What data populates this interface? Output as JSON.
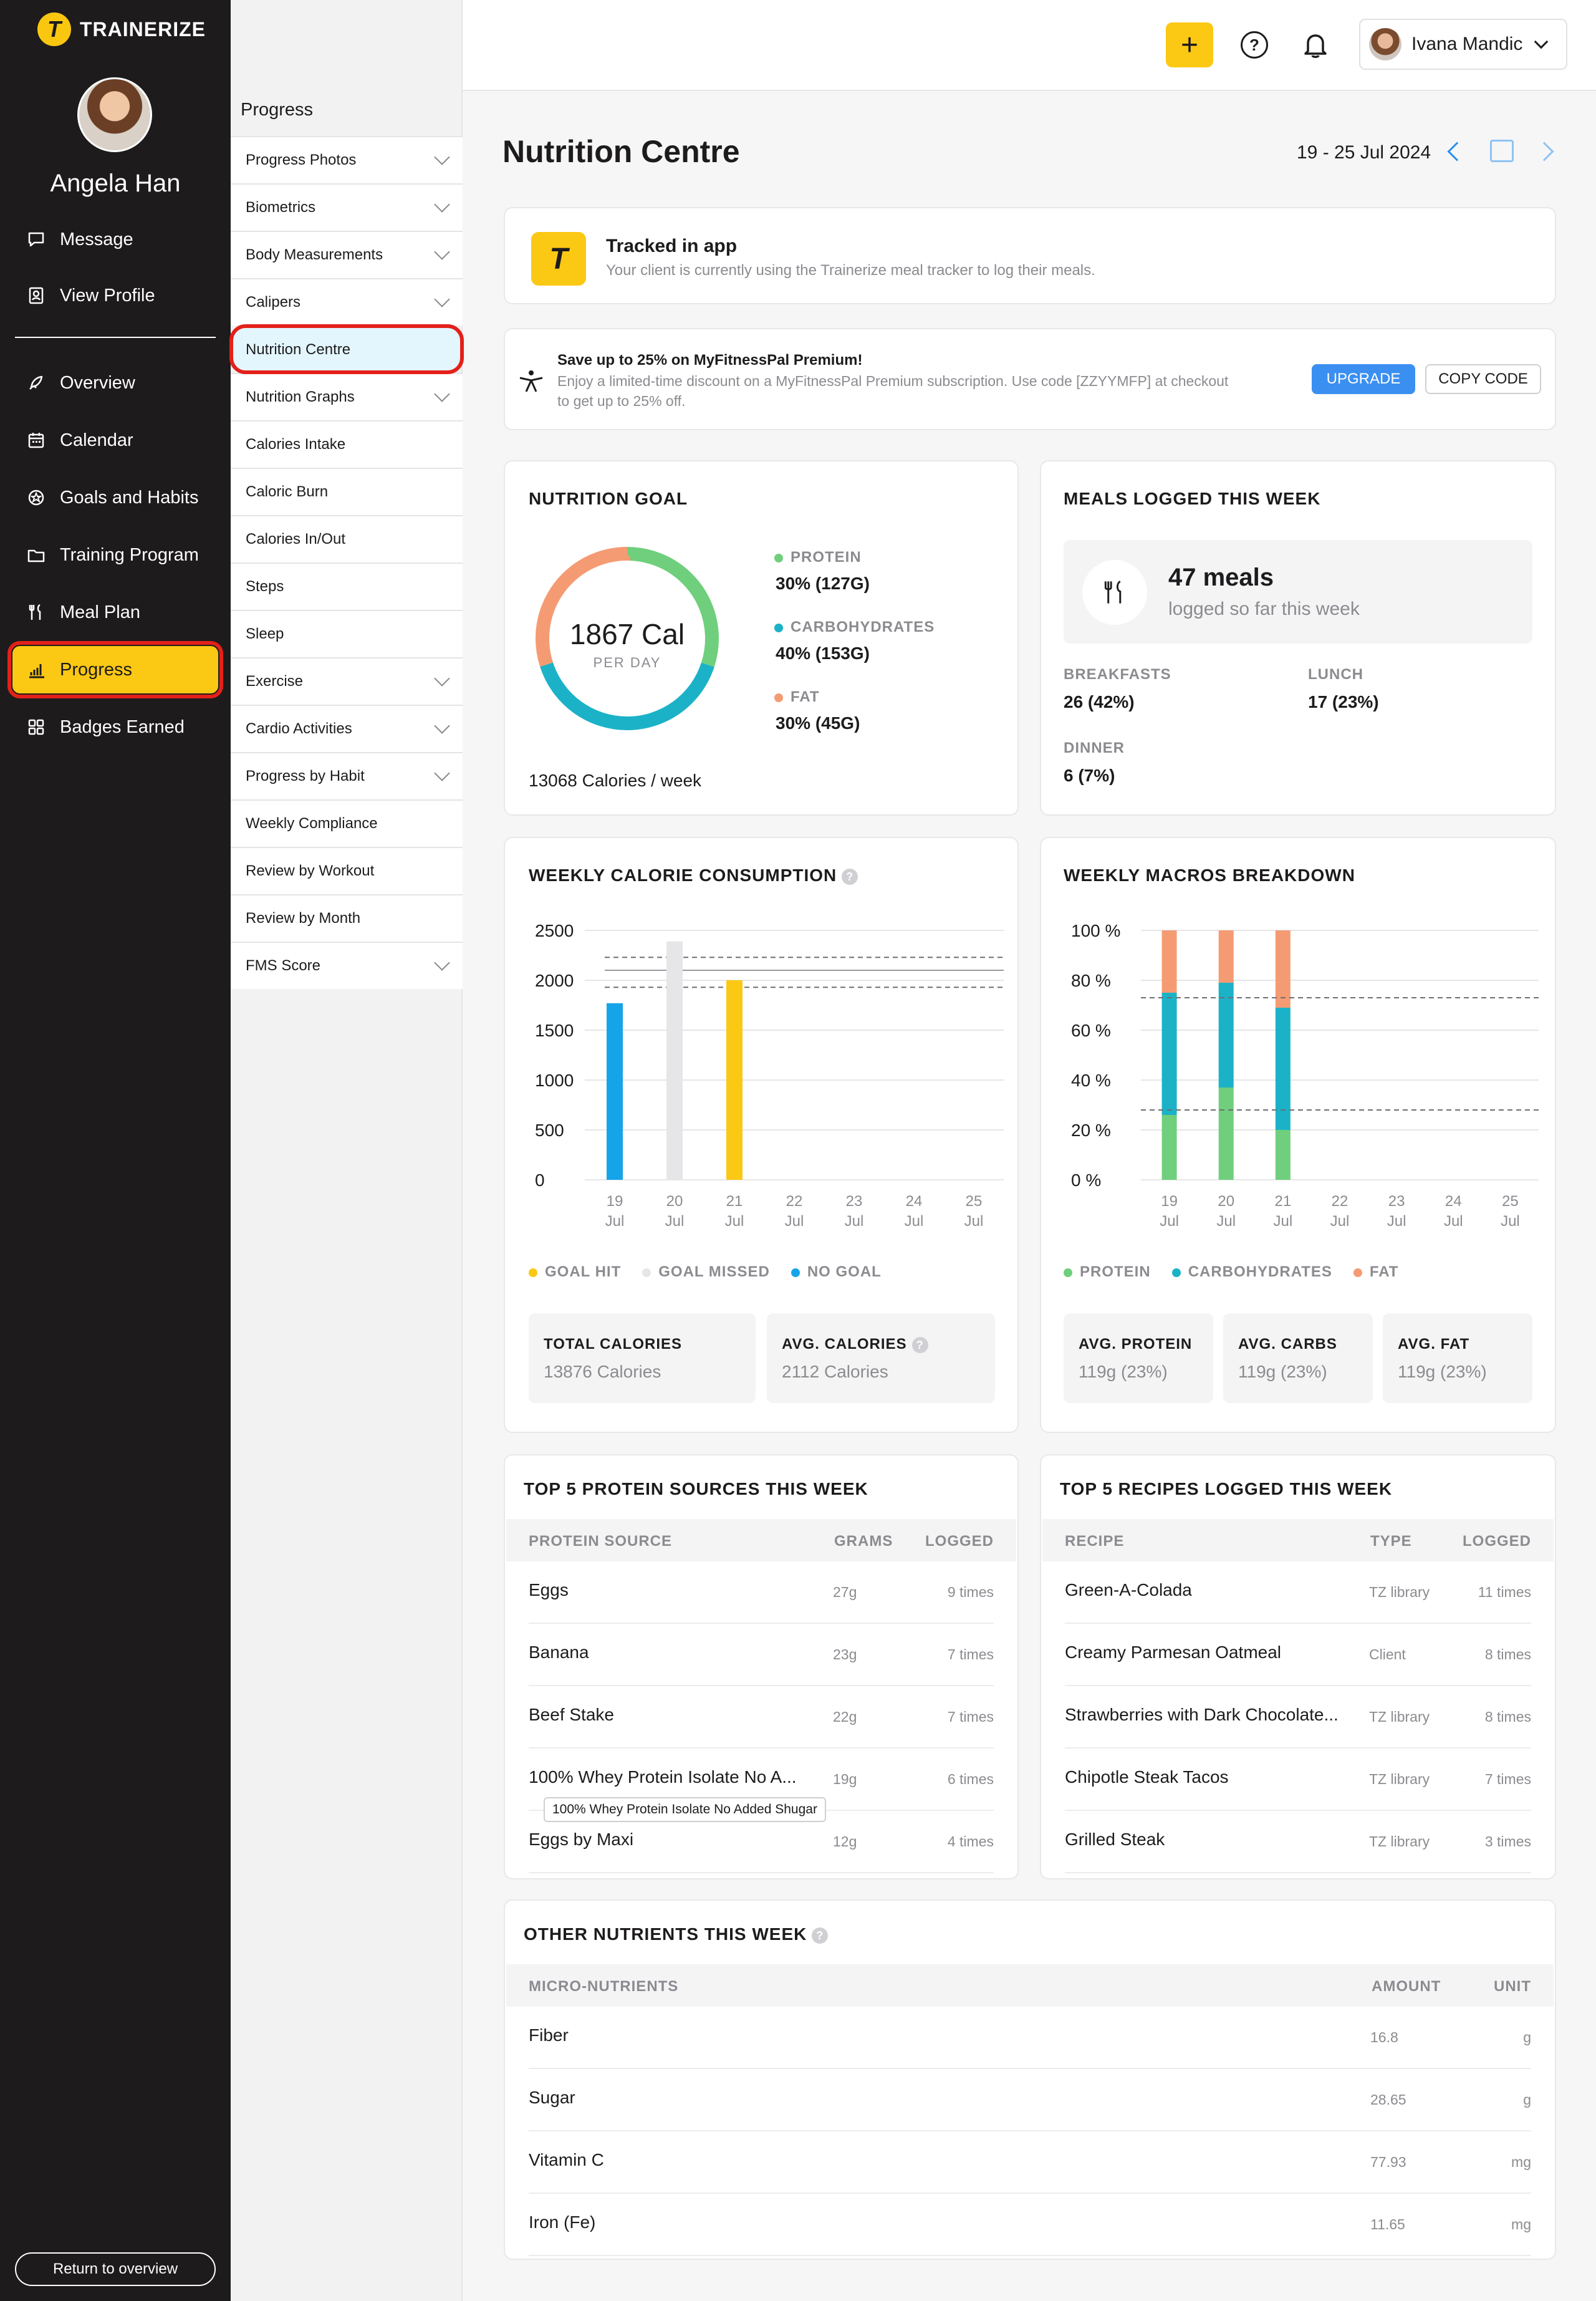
{
  "brand": {
    "name": "TRAINERIZE",
    "accent": "#fbc814",
    "dark": "#1d1b1c",
    "highlight": "#e32119"
  },
  "sidebar": {
    "user_name": "Angela Han",
    "top_items": [
      {
        "label": "Message",
        "icon": "message-icon"
      },
      {
        "label": "View Profile",
        "icon": "profile-icon"
      }
    ],
    "items": [
      {
        "label": "Overview",
        "icon": "rocket-icon"
      },
      {
        "label": "Calendar",
        "icon": "calendar-icon"
      },
      {
        "label": "Goals and Habits",
        "icon": "goal-icon"
      },
      {
        "label": "Training Program",
        "icon": "folder-icon"
      },
      {
        "label": "Meal Plan",
        "icon": "utensils-icon"
      },
      {
        "label": "Progress",
        "icon": "bar-chart-icon",
        "active": true
      },
      {
        "label": "Badges Earned",
        "icon": "grid-icon"
      }
    ],
    "return_label": "Return to overview"
  },
  "subnav": {
    "title": "Progress",
    "items": [
      {
        "label": "Progress Photos",
        "expandable": true
      },
      {
        "label": "Biometrics",
        "expandable": true
      },
      {
        "label": "Body Measurements",
        "expandable": true
      },
      {
        "label": "Calipers",
        "expandable": true
      },
      {
        "label": "Nutrition Centre",
        "expandable": false,
        "selected": true
      },
      {
        "label": "Nutrition Graphs",
        "expandable": true
      },
      {
        "label": "Calories Intake",
        "expandable": false
      },
      {
        "label": "Caloric Burn",
        "expandable": false
      },
      {
        "label": "Calories In/Out",
        "expandable": false
      },
      {
        "label": "Steps",
        "expandable": false
      },
      {
        "label": "Sleep",
        "expandable": false
      },
      {
        "label": "Exercise",
        "expandable": true
      },
      {
        "label": "Cardio Activities",
        "expandable": true
      },
      {
        "label": "Progress by Habit",
        "expandable": true
      },
      {
        "label": "Weekly Compliance",
        "expandable": false
      },
      {
        "label": "Review by Workout",
        "expandable": false
      },
      {
        "label": "Review by Month",
        "expandable": false
      },
      {
        "label": "FMS Score",
        "expandable": true
      }
    ]
  },
  "topbar": {
    "plus": "+",
    "help": "?",
    "account_name": "Ivana Mandic"
  },
  "main": {
    "title": "Nutrition Centre",
    "date_range": "19 - 25 Jul 2024",
    "tracked": {
      "title": "Tracked in app",
      "subtitle": "Your client is currently using the Trainerize meal tracker to log their meals."
    },
    "promo": {
      "title": "Save up to 25% on MyFitnessPal Premium!",
      "text_1": "Enjoy a limited-time discount on a MyFitnessPal Premium subscription. Use code [ZZYYMFP] at checkout",
      "text_2": "to get up to 25% off.",
      "upgrade_label": "UPGRADE",
      "copy_label": "COPY CODE"
    },
    "nutrition_goal": {
      "title": "NUTRITION GOAL",
      "calories": "1867 Cal",
      "per_day": "PER DAY",
      "weekly": "13068 Calories / week",
      "macros": [
        {
          "name": "PROTEIN",
          "value": "30% (127G)",
          "percent": 30,
          "color": "#6fcf7c"
        },
        {
          "name": "CARBOHYDRATES",
          "value": "40% (153G)",
          "percent": 40,
          "color": "#1bb2c8"
        },
        {
          "name": "FAT",
          "value": "30% (45G)",
          "percent": 30,
          "color": "#f59b73"
        }
      ]
    },
    "meals_logged": {
      "title": "MEALS LOGGED THIS WEEK",
      "count": "47 meals",
      "subtitle": "logged so far this week",
      "breakdown": [
        {
          "label": "BREAKFASTS",
          "value": "26 (42%)"
        },
        {
          "label": "LUNCH",
          "value": "17 (23%)"
        },
        {
          "label": "DINNER",
          "value": "6 (7%)"
        }
      ]
    },
    "calorie_consumption": {
      "title": "WEEKLY CALORIE CONSUMPTION",
      "legend": [
        {
          "label": "GOAL HIT",
          "color": "#fbc814"
        },
        {
          "label": "GOAL MISSED",
          "color": "#e6e6e8"
        },
        {
          "label": "NO GOAL",
          "color": "#16a4e8"
        }
      ],
      "stats": [
        {
          "label": "TOTAL CALORIES",
          "value": "13876 Calories"
        },
        {
          "label": "AVG. CALORIES",
          "value": "2112 Calories"
        }
      ]
    },
    "macros_breakdown": {
      "title": "WEEKLY MACROS BREAKDOWN",
      "legend": [
        {
          "label": "PROTEIN",
          "color": "#6fcf7c"
        },
        {
          "label": "CARBOHYDRATES",
          "color": "#1bb2c8"
        },
        {
          "label": "FAT",
          "color": "#f59b73"
        }
      ],
      "stats": [
        {
          "label": "AVG. PROTEIN",
          "value": "119g (23%)"
        },
        {
          "label": "AVG. CARBS",
          "value": "119g (23%)"
        },
        {
          "label": "AVG. FAT",
          "value": "119g (23%)"
        }
      ]
    },
    "protein_sources": {
      "title": "TOP 5 PROTEIN SOURCES THIS WEEK",
      "headers": [
        "PROTEIN SOURCE",
        "GRAMS",
        "LOGGED"
      ],
      "rows": [
        {
          "name": "Eggs",
          "grams": "27g",
          "logged": "9 times"
        },
        {
          "name": "Banana",
          "grams": "23g",
          "logged": "7 times"
        },
        {
          "name": "Beef Stake",
          "grams": "22g",
          "logged": "7 times"
        },
        {
          "name": "100% Whey Protein Isolate No A...",
          "grams": "19g",
          "logged": "6 times"
        },
        {
          "name": "Eggs by Maxi",
          "grams": "12g",
          "logged": "4 times"
        }
      ],
      "tooltip": "100% Whey Protein Isolate No Added Shugar"
    },
    "recipes": {
      "title": "TOP 5 RECIPES LOGGED THIS WEEK",
      "headers": [
        "RECIPE",
        "TYPE",
        "LOGGED"
      ],
      "rows": [
        {
          "name": "Green-A-Colada",
          "type": "TZ library",
          "logged": "11 times"
        },
        {
          "name": "Creamy Parmesan Oatmeal",
          "type": "Client",
          "logged": "8 times"
        },
        {
          "name": "Strawberries with Dark Chocolate...",
          "type": "TZ library",
          "logged": "8 times"
        },
        {
          "name": "Chipotle Steak Tacos",
          "type": "TZ library",
          "logged": "7 times"
        },
        {
          "name": "Grilled Steak",
          "type": "TZ library",
          "logged": "3 times"
        }
      ]
    },
    "other_nutrients": {
      "title": "OTHER NUTRIENTS THIS WEEK",
      "headers": [
        "MICRO-NUTRIENTS",
        "AMOUNT",
        "UNIT"
      ],
      "rows": [
        {
          "name": "Fiber",
          "amount": "16.8",
          "unit": "g"
        },
        {
          "name": "Sugar",
          "amount": "28.65",
          "unit": "g"
        },
        {
          "name": "Vitamin C",
          "amount": "77.93",
          "unit": "mg"
        },
        {
          "name": "Iron (Fe)",
          "amount": "11.65",
          "unit": "mg"
        }
      ]
    }
  },
  "chart_data": [
    {
      "type": "bar",
      "title": "WEEKLY CALORIE CONSUMPTION",
      "categories": [
        "19 Jul",
        "20 Jul",
        "21 Jul",
        "22 Jul",
        "23 Jul",
        "24 Jul",
        "25 Jul"
      ],
      "x_ticks": [
        [
          "19",
          "Jul"
        ],
        [
          "20",
          "Jul"
        ],
        [
          "21",
          "Jul"
        ],
        [
          "22",
          "Jul"
        ],
        [
          "23",
          "Jul"
        ],
        [
          "24",
          "Jul"
        ],
        [
          "25",
          "Jul"
        ]
      ],
      "values": [
        1770,
        2390,
        2000,
        null,
        null,
        null,
        null
      ],
      "bar_status": [
        "NO GOAL",
        "GOAL MISSED",
        "GOAL HIT",
        null,
        null,
        null,
        null
      ],
      "bar_colors": [
        "#16a4e8",
        "#e6e6e8",
        "#fbc814",
        null,
        null,
        null,
        null
      ],
      "goal_line": 2100,
      "goal_band": [
        1930,
        2230
      ],
      "ylim": [
        0,
        2500
      ],
      "y_ticks": [
        "2500",
        "2000",
        "1500",
        "1000",
        "500",
        "0"
      ],
      "y_tick_values": [
        2500,
        2000,
        1500,
        1000,
        500,
        0
      ],
      "grid": true
    },
    {
      "type": "bar",
      "stacked": true,
      "title": "WEEKLY MACROS BREAKDOWN",
      "categories": [
        "19 Jul",
        "20 Jul",
        "21 Jul",
        "22 Jul",
        "23 Jul",
        "24 Jul",
        "25 Jul"
      ],
      "x_ticks": [
        [
          "19",
          "Jul"
        ],
        [
          "20",
          "Jul"
        ],
        [
          "21",
          "Jul"
        ],
        [
          "22",
          "Jul"
        ],
        [
          "23",
          "Jul"
        ],
        [
          "24",
          "Jul"
        ],
        [
          "25",
          "Jul"
        ]
      ],
      "series": [
        {
          "name": "PROTEIN",
          "color": "#6fcf7c",
          "values": [
            26,
            37,
            20,
            null,
            null,
            null,
            null
          ]
        },
        {
          "name": "CARBOHYDRATES",
          "color": "#1bb2c8",
          "values": [
            49,
            42,
            49,
            null,
            null,
            null,
            null
          ]
        },
        {
          "name": "FAT",
          "color": "#f59b73",
          "values": [
            25,
            21,
            31,
            null,
            null,
            null,
            null
          ]
        }
      ],
      "reference_lines": [
        73,
        28
      ],
      "ylim": [
        0,
        100
      ],
      "y_ticks": [
        "100 %",
        "80 %",
        "60 %",
        "40 %",
        "20 %",
        "0 %"
      ],
      "y_tick_values": [
        100,
        80,
        60,
        40,
        20,
        0
      ],
      "grid": true
    },
    {
      "type": "pie",
      "title": "NUTRITION GOAL",
      "categories": [
        "PROTEIN",
        "CARBOHYDRATES",
        "FAT"
      ],
      "values": [
        30,
        40,
        30
      ],
      "colors": [
        "#6fcf7c",
        "#1bb2c8",
        "#f59b73"
      ]
    }
  ]
}
